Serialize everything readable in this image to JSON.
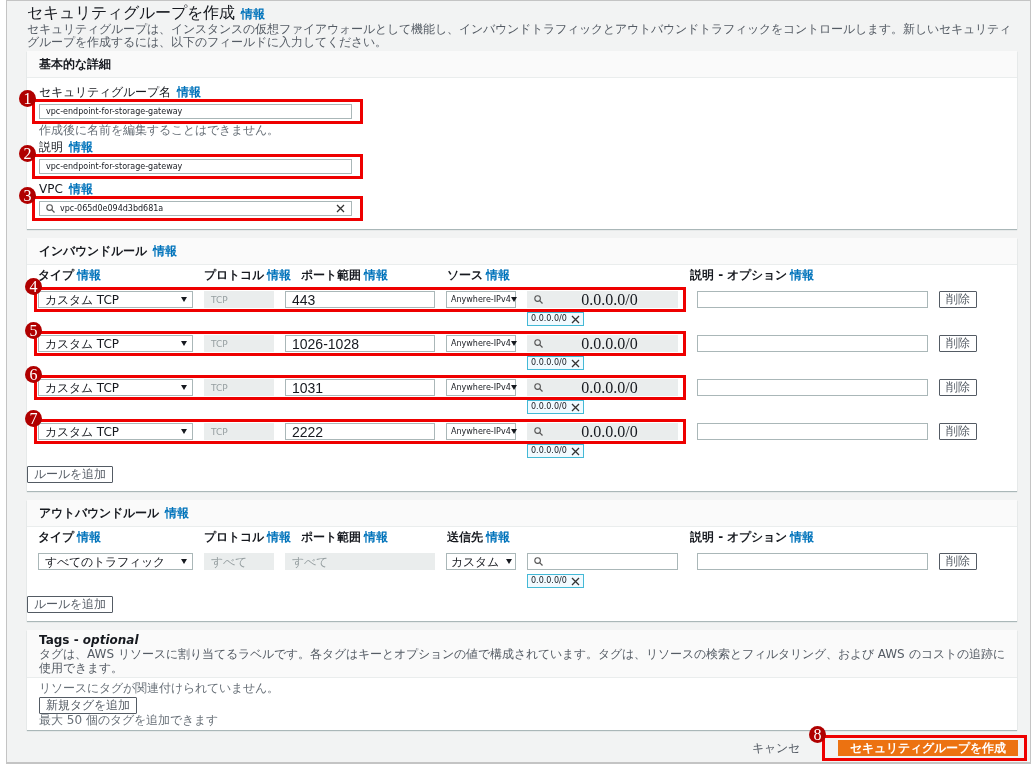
{
  "page": {
    "title": "セキュリティグループを作成",
    "info": "情報",
    "description": "セキュリティグループは、インスタンスの仮想ファイアウォールとして機能し、インバウンドトラフィックとアウトバウンドトラフィックをコントロールします。新しいセキュリティグループを作成するには、以下のフィールドに入力してください。"
  },
  "basic": {
    "title": "基本的な詳細",
    "fields": [
      {
        "label": "セキュリティグループ名",
        "info": "情報",
        "kind": "text",
        "value": "vpc-endpoint-for-storage-gateway",
        "hint": "作成後に名前を編集することはできません。",
        "callout": "1"
      },
      {
        "label": "説明",
        "info": "情報",
        "kind": "text",
        "value": "vpc-endpoint-for-storage-gateway",
        "callout": "2"
      },
      {
        "label": "VPC",
        "info": "情報",
        "kind": "search",
        "value": "vpc-065d0e094d3bd681a",
        "callout": "3"
      }
    ]
  },
  "inbound": {
    "title": "インバウンドルール",
    "info": "情報",
    "columns": [
      {
        "label": "タイプ",
        "info": "情報"
      },
      {
        "label": "プロトコル",
        "info": "情報"
      },
      {
        "label": "ポート範囲",
        "info": "情報"
      },
      {
        "label": "ソース",
        "info": "情報"
      },
      {
        "label": "説明 - オプション",
        "info": "情報"
      }
    ],
    "rules": [
      {
        "type": "カスタム TCP",
        "protocol": "TCP",
        "port_range": "443",
        "port_disabled": false,
        "source": "Anywhere-IPv4",
        "search": "0.0.0.0/0",
        "chips": [
          "0.0.0.0/0"
        ],
        "delete": "削除",
        "callout": "4"
      },
      {
        "type": "カスタム TCP",
        "protocol": "TCP",
        "port_range": "1026-1028",
        "port_disabled": false,
        "source": "Anywhere-IPv4",
        "search": "0.0.0.0/0",
        "chips": [
          "0.0.0.0/0"
        ],
        "delete": "削除",
        "callout": "5"
      },
      {
        "type": "カスタム TCP",
        "protocol": "TCP",
        "port_range": "1031",
        "port_disabled": false,
        "source": "Anywhere-IPv4",
        "search": "0.0.0.0/0",
        "chips": [
          "0.0.0.0/0"
        ],
        "delete": "削除",
        "callout": "6"
      },
      {
        "type": "カスタム TCP",
        "protocol": "TCP",
        "port_range": "2222",
        "port_disabled": false,
        "source": "Anywhere-IPv4",
        "search": "0.0.0.0/0",
        "chips": [
          "0.0.0.0/0"
        ],
        "delete": "削除",
        "callout": "7"
      }
    ],
    "add_button": "ルールを追加"
  },
  "outbound": {
    "title": "アウトバウンドルール",
    "info": "情報",
    "columns": [
      {
        "label": "タイプ",
        "info": "情報"
      },
      {
        "label": "プロトコル",
        "info": "情報"
      },
      {
        "label": "ポート範囲",
        "info": "情報"
      },
      {
        "label": "送信先",
        "info": "情報"
      },
      {
        "label": "説明 - オプション",
        "info": "情報"
      }
    ],
    "rules": [
      {
        "type": "すべてのトラフィック",
        "protocol": "すべて",
        "port_range": "すべて",
        "port_disabled": true,
        "source": "カスタム",
        "chips": [
          "0.0.0.0/0"
        ],
        "delete": "削除"
      }
    ],
    "add_button": "ルールを追加"
  },
  "tags": {
    "title": "Tags - *optional*",
    "description": "タグは、AWS リソースに割り当てるラベルです。各タグはキーとオプションの値で構成されています。タグは、リソースの検索とフィルタリング、および AWS のコストの追跡に使用できます。",
    "empty_text": "リソースにタグが関連付けられていません。",
    "add_button": "新規タグを追加",
    "hint": "最大 50 個のタグを追加できます"
  },
  "footer": {
    "cancel": "キャンセ",
    "create": "セキュリティグループを作成",
    "callout": "8"
  }
}
